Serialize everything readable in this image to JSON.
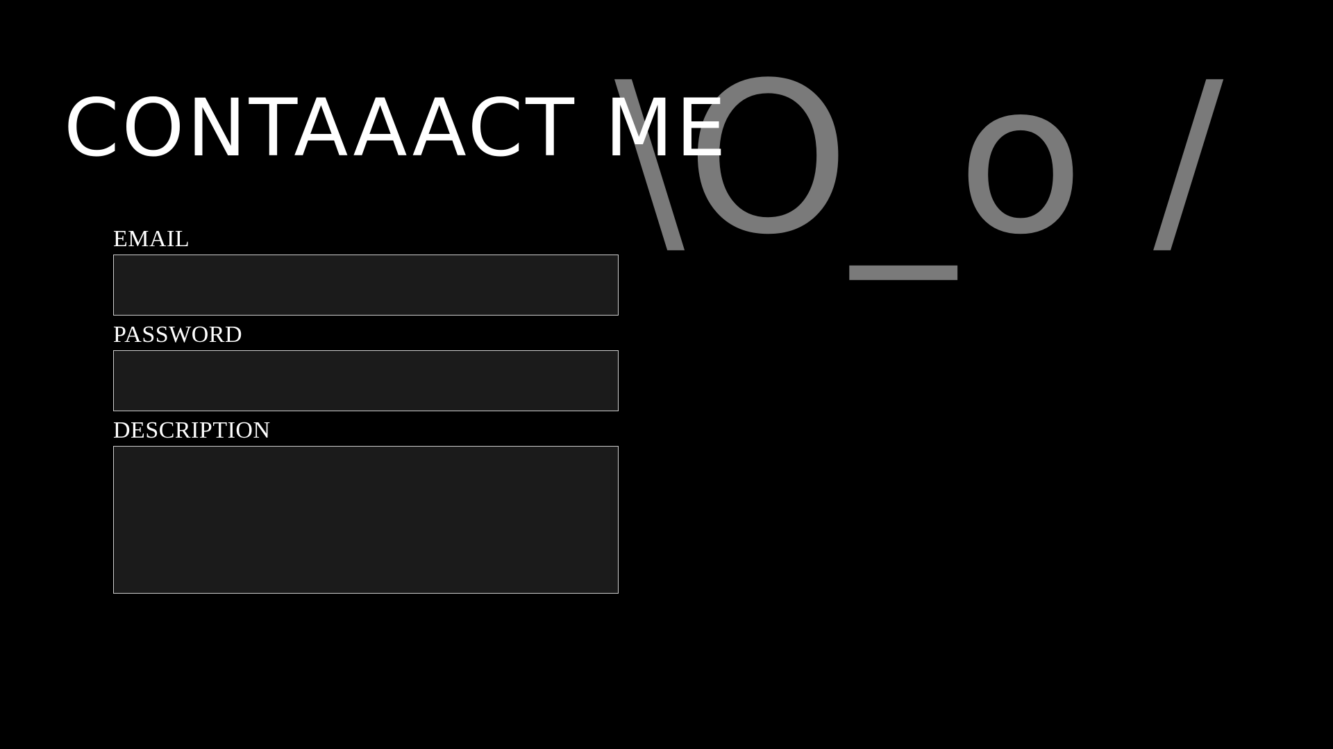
{
  "page": {
    "title": "CONTAAACT ME",
    "emoticon": "\\O_o /"
  },
  "form": {
    "email": {
      "label": "EMAIL",
      "value": ""
    },
    "password": {
      "label": "PASSWORD",
      "value": ""
    },
    "description": {
      "label": "DESCRIPTION",
      "value": ""
    }
  },
  "colors": {
    "background": "#000000",
    "text": "#ffffff",
    "emoticon": "#7a7a7a",
    "input_background": "#1b1b1b",
    "input_border": "#cfcfcf"
  }
}
